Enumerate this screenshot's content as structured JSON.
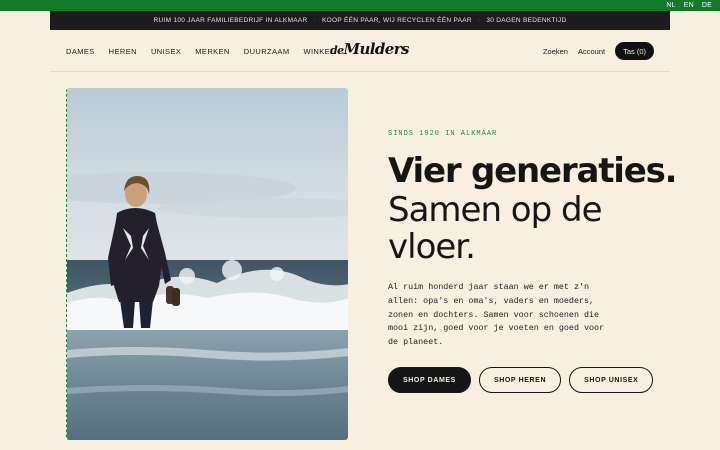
{
  "languages": [
    "NL",
    "EN",
    "DE"
  ],
  "announcement": [
    "RUIM 100 JAAR FAMILIEBEDRIJF IN ALKMAAR",
    "KOOP ÉÉN PAAR, WIJ RECYCLEN ÉÉN PAAR",
    "30 DAGEN BEDENKTIJD"
  ],
  "nav": {
    "items": [
      "DAMES",
      "HEREN",
      "UNISEX",
      "MERKEN",
      "DUURZAAM",
      "WINKEL"
    ],
    "logo_prefix": "de",
    "logo_name": "Mulders",
    "search_label": "Zoeken",
    "account_label": "Account",
    "bag_label": "Tas (0)"
  },
  "hero": {
    "eyebrow": "SINDS 1920 IN ALKMAAR",
    "title_bold": "Vier generaties.",
    "title_light": "Samen op de vloer.",
    "body": "Al ruim honderd jaar staan we er met z'n allen: opa's en oma's, vaders en moeders, zonen en dochters. Samen voor schoenen die mooi zijn, goed voor je voeten en goed voor de planeet.",
    "buttons": [
      "SHOP DAMES",
      "SHOP HEREN",
      "SHOP UNISEX"
    ]
  },
  "colors": {
    "background": "#f8efe1",
    "brand_green": "#137a2c",
    "dark": "#151515"
  }
}
